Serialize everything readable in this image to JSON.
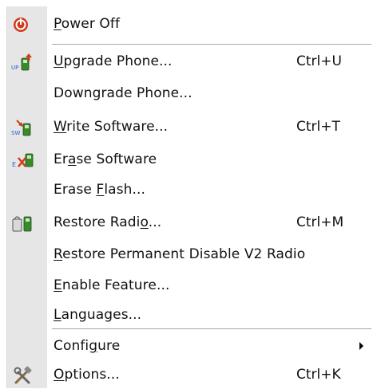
{
  "menu": {
    "items": [
      {
        "id": "power_off",
        "pre": "",
        "key": "P",
        "post": "ower Off",
        "shortcut": "",
        "icon": "power-icon"
      },
      {
        "id": "upgrade_phone",
        "pre": "",
        "key": "U",
        "post": "pgrade Phone...",
        "shortcut": "Ctrl+U",
        "icon": "upgrade-phone-icon"
      },
      {
        "id": "downgrade_phone",
        "pre": "Downgrade Phone...",
        "key": "",
        "post": "",
        "shortcut": "",
        "icon": ""
      },
      {
        "id": "write_software",
        "pre": "",
        "key": "W",
        "post": "rite Software...",
        "shortcut": "Ctrl+T",
        "icon": "write-software-icon"
      },
      {
        "id": "erase_software",
        "pre": "Er",
        "key": "a",
        "post": "se Software",
        "shortcut": "",
        "icon": "erase-software-icon"
      },
      {
        "id": "erase_flash",
        "pre": "Erase ",
        "key": "F",
        "post": "lash...",
        "shortcut": "",
        "icon": ""
      },
      {
        "id": "restore_radio",
        "pre": "Restore Radi",
        "key": "o",
        "post": "...",
        "shortcut": "Ctrl+M",
        "icon": "restore-radio-icon"
      },
      {
        "id": "restore_permanent",
        "pre": "",
        "key": "R",
        "post": "estore Permanent Disable V2 Radio",
        "shortcut": "",
        "icon": ""
      },
      {
        "id": "enable_feature",
        "pre": "",
        "key": "E",
        "post": "nable Feature...",
        "shortcut": "",
        "icon": ""
      },
      {
        "id": "languages",
        "pre": "",
        "key": "L",
        "post": "anguages...",
        "shortcut": "",
        "icon": ""
      },
      {
        "id": "configure",
        "pre": "Confi",
        "key": "g",
        "post": "ure",
        "shortcut": "",
        "icon": "",
        "submenu": true
      },
      {
        "id": "options",
        "pre": "",
        "key": "O",
        "post": "ptions...",
        "shortcut": "Ctrl+K",
        "icon": "tools-icon"
      }
    ]
  },
  "colors": {
    "gutter": "#e6e6e6",
    "power_red": "#d03a1a",
    "phone_green": "#3a8a2a",
    "arrow_blue": "#2a5ad8"
  }
}
